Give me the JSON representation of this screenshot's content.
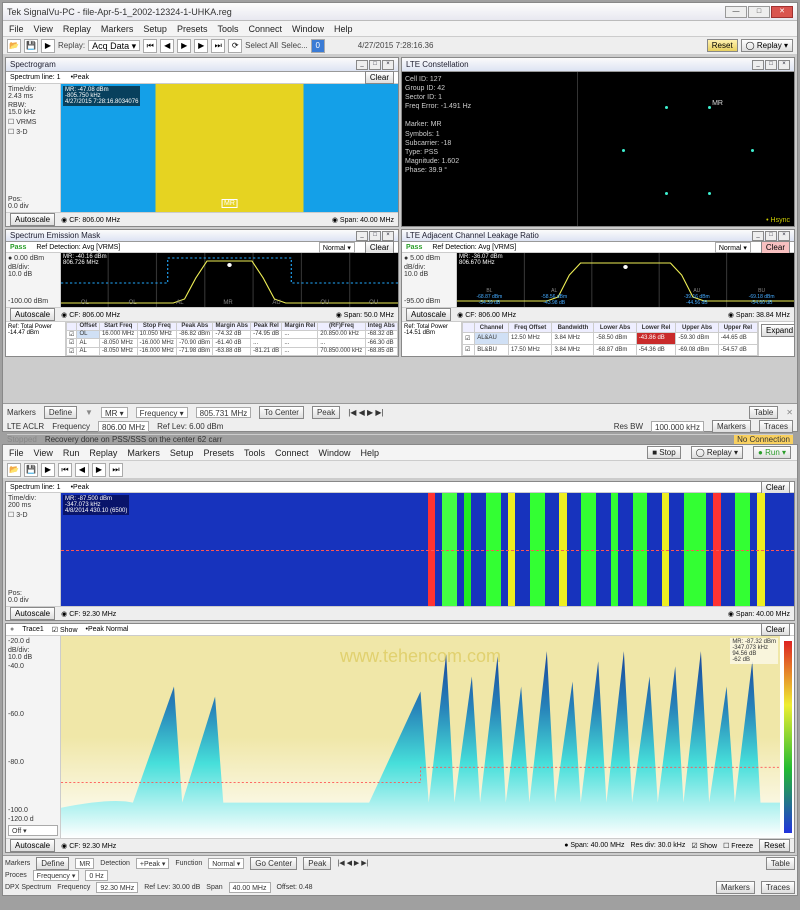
{
  "app1": {
    "title": "Tek SignalVu-PC - file-Apr-5-1_2002-12324-1-UHKA.reg",
    "menus": [
      "File",
      "View",
      "Replay",
      "Markers",
      "Setup",
      "Presets",
      "Tools",
      "Connect",
      "Window",
      "Help"
    ],
    "toolbar": {
      "replay_label": "Replay:",
      "acq_data": "Acq Data ▾",
      "select_all": "Select All",
      "select": "Selec...",
      "count": "0",
      "timestamp": "4/27/2015 7:28:16.36",
      "reset": "Reset",
      "replay_btn": "◯ Replay ▾"
    },
    "spectrogram": {
      "title": "Spectrogram",
      "line": "Spectrum line: 1",
      "peak": "•Peak",
      "time_div": "Time/div:\n2.43 ms",
      "rbw": "RBW:\n15.0 kHz",
      "vrms": "☐ VRMS",
      "three_d": "☐ 3-D",
      "pos": "Pos:\n0.0 div",
      "marker_txt": "MR: -47.08 dBm\n-805.750 kHz\n4/27/2015 7:28:16.8034076",
      "autoscale": "Autoscale",
      "cf": "◉ CF: 806.00 MHz",
      "span": "◉ Span: 40.00 MHz",
      "clear": "Clear"
    },
    "constellation": {
      "title": "LTE Constellation",
      "cell_id": "Cell ID: 127",
      "group_id": "Group ID: 42",
      "sector_id": "Sector ID: 1",
      "freq_err": "Freq Error: -1.491 Hz",
      "marker": "Marker: MR",
      "symbols": "Symbols: 1",
      "subcarr": "Subcarrier: -18",
      "type": "Type: PSS",
      "magnitude": "Magnitude: 1.602",
      "phase": "Phase: 39.9 °",
      "hsync": "• Hsync"
    },
    "sem": {
      "title": "Spectrum Emission Mask",
      "pass": "Pass",
      "ref_det": "Ref Detection: Avg [VRMS]",
      "normal": "Normal ▾",
      "clear": "Clear",
      "scale1": "● 0.00 dBm",
      "scale2": "dB/div:\n10.0 dB",
      "scale3": "-100.00 dBm",
      "mr": "MR: -40.16 dBm\n806.726 MHz",
      "bands": [
        "OL",
        "OL",
        "AL",
        "",
        "AU",
        "OU",
        "OU"
      ],
      "autoscale": "Autoscale",
      "cf": "◉ CF: 806.00 MHz",
      "span": "◉ Span: 50.0 MHz",
      "ref_total": "Ref: Total Power",
      "ref_val": "-14.47 dBm",
      "table": {
        "headers": [
          "",
          "Offset",
          "Start Freq",
          "Stop Freq",
          "Peak Abs",
          "Margin Abs",
          "Peak Rel",
          "Margin Rel",
          "(RF)Freq",
          "Integ Abs"
        ],
        "rows": [
          [
            "☑",
            "OL",
            "16.000 MHz",
            "10.050 MHz",
            "-86.82 dBm",
            "-74.32 dB",
            "-74.95 dB",
            "...",
            "20.850.00 kHz",
            "-68.32 dB"
          ],
          [
            "☑",
            "AL",
            "-8.050 MHz",
            "-16.000 MHz",
            "-70.90 dBm",
            "-61.40 dB",
            "...",
            "...",
            "...",
            "-66.30 dB"
          ],
          [
            "☑",
            "AL",
            "-8.050 MHz",
            "-16.000 MHz",
            "-71.98 dBm",
            "-63.88 dB",
            "-81.21 dB",
            "...",
            "70.850.000 kHz",
            "-68.85 dB"
          ]
        ]
      }
    },
    "aclr": {
      "title": "LTE Adjacent Channel Leakage Ratio",
      "pass": "Pass",
      "ref_det": "Ref Detection: Avg [VRMS]",
      "normal": "Normal ▾",
      "clear": "Clear",
      "scale1": "● 5.00 dBm",
      "scale2": "dB/div:\n10.0 dB",
      "scale3": "-95.00 dBm",
      "mr": "MR: -36.07 dBm\n806.670 MHz",
      "bands": [
        "BL",
        "AL",
        "",
        "AU",
        "BU"
      ],
      "band_vals": [
        [
          "-68.87 dBm",
          "-54.39 dB"
        ],
        [
          "-58.56 dBm",
          "-43.98 dB"
        ],
        "",
        [
          "-39.16 dBm",
          "-44.56 dB"
        ],
        [
          "-69.18 dBm",
          "-54.60 dB"
        ]
      ],
      "autoscale": "Autoscale",
      "cf": "◉ CF: 806.00 MHz",
      "span": "◉ Span: 38.84 MHz",
      "ref_total": "Ref: Total Power",
      "ref_val": "-14.51 dBm",
      "expand": "Expand",
      "table": {
        "headers": [
          "",
          "Channel",
          "Freq Offset",
          "Bandwidth",
          "Lower Abs",
          "Lower Rel",
          "Upper Abs",
          "Upper Rel"
        ],
        "rows": [
          [
            "☑",
            "AL&AU",
            "12.50 MHz",
            "3.84 MHz",
            "-58.50 dBm",
            "-43.86 dB",
            "-59.30 dBm",
            "-44.65 dB"
          ],
          [
            "☑",
            "BL&BU",
            "17.50 MHz",
            "3.84 MHz",
            "-68.87 dBm",
            "-54.36 dB",
            "-69.08 dBm",
            "-54.57 dB"
          ]
        ]
      }
    },
    "status": {
      "markers": "Markers",
      "define": "Define",
      "mr_sel": "MR ▾",
      "frequency": "Frequency ▾",
      "freq_val": "805.731 MHz",
      "to_center": "To Center",
      "peak": "Peak",
      "table_btn": "Table",
      "lte_aclr": "LTE ACLR",
      "freq2": "Frequency",
      "freq2_val": "806.00 MHz",
      "ref_lev": "Ref Lev: 6.00 dBm",
      "rbw": "Res BW",
      "rbw_val": "100.000 kHz",
      "markers2": "Markers",
      "traces": "Traces",
      "stopped": "Stopped",
      "recovery": "Recovery done on PSS/SSS on the center 62 carr",
      "no_conn": "No Connection"
    }
  },
  "app2": {
    "menus": [
      "File",
      "View",
      "Run",
      "Replay",
      "Markers",
      "Setup",
      "Presets",
      "Tools",
      "Connect",
      "Window",
      "Help"
    ],
    "toolbar": {
      "stop": "■ Stop",
      "replay": "◯ Replay ▾",
      "run": "● Run ▾"
    },
    "spectrogram": {
      "title": "Spectrogram",
      "line": "Spectrum line: 1",
      "peak": "•Peak",
      "time_div": "Time/div:\n200 ms",
      "three_d": "☐ 3-D",
      "pos": "Pos:\n0.0 div",
      "marker_txt": "MR: -87.500 dBm\n-347.073 kHz\n4/8/2014 430.10 (6500)",
      "autoscale": "Autoscale",
      "cf": "◉ CF: 92.30 MHz",
      "span": "◉ Span: 40.00 MHz",
      "clear": "Clear"
    },
    "dpx": {
      "title": "Trace1",
      "show": "☑ Show",
      "mode": "•Peak Normal",
      "clear": "Clear",
      "watermark": "www.tehencom.com",
      "readout": "MR: -87.32 dBm\n-347.073 kHz\n94.56 dB\n-62 dB",
      "scale_top": "-20.0 d",
      "scale_div": "dB/div:\n10.0 dB",
      "scale1": "-40.0",
      "scale2": "-60.0",
      "scale3": "-80.0",
      "scale4": "-100.0",
      "scale_bot": "-120.0 d",
      "off": "Off ▾",
      "autoscale": "Autoscale",
      "cf": "◉ CF: 92.30 MHz",
      "span": "● Span: 40.00 MHz",
      "res_div": "Res div: 30.0 kHz",
      "show_btn": "☑ Show",
      "freeze": "☐ Freeze",
      "reset": "Reset"
    },
    "status": {
      "markers": "Markers",
      "define": "Define",
      "mr": "MR",
      "detection": "Detection",
      "peak_p": "+Peak ▾",
      "function": "Function",
      "normal": "Normal ▾",
      "go_center": "Go Center",
      "peak": "Peak",
      "table": "Table",
      "dpx_spectrum": "DPX Spectrum",
      "frequency": "Frequency",
      "freq_val": "92.30 MHz",
      "ref_lev": "Ref Lev: 30.00 dB",
      "span_lbl": "Span",
      "span_val": "40.00 MHz",
      "offset": "Offset: 0.48",
      "markers2": "Markers",
      "traces": "Traces",
      "proces": "Proces",
      "frequency2": "Frequency ▾",
      "freq2_val": "0 Hz"
    }
  }
}
